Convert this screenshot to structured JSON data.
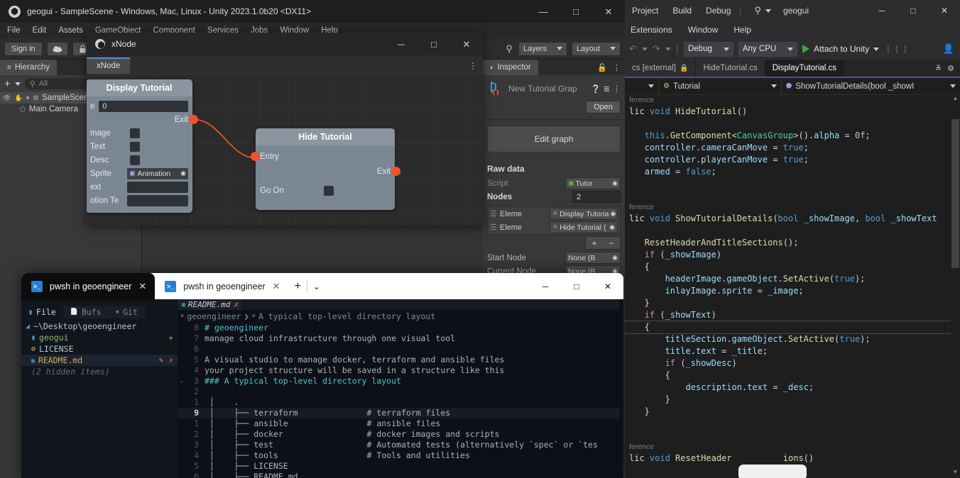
{
  "unity": {
    "title": "geogui - SampleScene - Windows, Mac, Linux - Unity 2023.1.0b20 <DX11>",
    "menu": [
      "File",
      "Edit",
      "Assets",
      "GameObject",
      "Component",
      "Services",
      "Jobs",
      "Window",
      "Help"
    ],
    "toolbar": {
      "sign_in": "Sign in",
      "cloud_icon": "cloud-icon",
      "account_icon": "lock-icon",
      "search_icon": "search-icon",
      "layers": "Layers",
      "layout": "Layout"
    },
    "hierarchy": {
      "tab": "Hierarchy",
      "add_label": "+",
      "search_placeholder": "All",
      "rows": [
        {
          "label": "SampleScene",
          "icon": "unity-scene-icon"
        },
        {
          "label": "Main Camera",
          "icon": "gameobject-icon"
        }
      ]
    },
    "inspector": {
      "tab": "Inspector",
      "lock_icon": "lock-icon",
      "kebab_icon": "kebab-icon",
      "asset_title": "New Tutorial Grap",
      "help_icon": "help-icon",
      "preset_icon": "preset-icon",
      "open_button": "Open",
      "edit_graph_button": "Edit graph",
      "raw_data_label": "Raw data",
      "script_label": "Script",
      "script_value": "Tutor",
      "nodes_label": "Nodes",
      "nodes_value": "2",
      "elements": [
        {
          "label": "Eleme",
          "value": "Display Tutoria"
        },
        {
          "label": "Eleme",
          "value": "Hide Tutorial ("
        }
      ],
      "plus": "+",
      "minus": "−",
      "start_node_label": "Start Node",
      "start_node_value": "None (B",
      "current_node_label": "Current Node",
      "current_node_value": "None (B"
    }
  },
  "xnode": {
    "window_title": "xNode",
    "tab": "xNode",
    "kebab_icon": "kebab-icon",
    "minimize": "─",
    "maximize": "□",
    "close": "✕",
    "nodes": [
      {
        "title": "Display Tutorial",
        "rows": [
          {
            "label": "e",
            "type": "field",
            "value": "0"
          },
          {
            "label": "Exit",
            "type": "port"
          },
          {
            "label": "mage",
            "type": "check"
          },
          {
            "label": "Text",
            "type": "check"
          },
          {
            "label": "Desc",
            "type": "check"
          },
          {
            "label": "Sprite",
            "type": "object",
            "value": "Animation"
          },
          {
            "label": "ext",
            "type": "field",
            "value": ""
          },
          {
            "label": "otion Te",
            "type": "field",
            "value": ""
          }
        ]
      },
      {
        "title": "Hide Tutorial",
        "rows": [
          {
            "label": "Entry",
            "type": "port-in"
          },
          {
            "label": "Exit",
            "type": "port-out"
          },
          {
            "label": "Go On",
            "type": "check"
          }
        ]
      }
    ]
  },
  "terminal": {
    "tabs": [
      {
        "label": "pwsh in geoengineer",
        "active": true,
        "icon": "pwsh-icon",
        "close": "✕"
      },
      {
        "label": "pwsh in geoengineer",
        "active": false,
        "icon": "pwsh-icon",
        "close": "✕"
      }
    ],
    "new_tab": "+",
    "dropdown": "⌄",
    "minimize": "─",
    "maximize": "□",
    "close": "✕",
    "tree": {
      "tabs": [
        {
          "label": "File",
          "icon": "folder-icon",
          "active": true
        },
        {
          "label": "Bufs",
          "icon": "buffer-icon",
          "active": false
        },
        {
          "label": "Git",
          "icon": "git-icon",
          "active": false
        }
      ],
      "root": "~\\Desktop\\geoengineer",
      "items": [
        {
          "label": "geogui",
          "icon": "folder-icon",
          "badge": "+",
          "selected": false
        },
        {
          "label": "LICENSE",
          "icon": "license-icon",
          "badge": "",
          "selected": false
        },
        {
          "label": "README.md",
          "icon": "markdown-icon",
          "badge": "✎",
          "badge2": "✗",
          "selected": true
        }
      ],
      "hidden_note": "(2 hidden items)"
    },
    "buffer_tab": {
      "label": "README.md",
      "icon": "markdown-icon",
      "close": "✗"
    },
    "breadcrumb": [
      "geoengineer",
      "A typical top-level directory layout"
    ],
    "lines": [
      {
        "num": "8",
        "fold": "",
        "text": "# geoengineer",
        "style": "head"
      },
      {
        "num": "7",
        "fold": "",
        "text": "manage cloud infrastructure through one visual tool",
        "style": "plain"
      },
      {
        "num": "6",
        "fold": "",
        "text": "",
        "style": "plain"
      },
      {
        "num": "5",
        "fold": "",
        "text": "A visual studio to manage docker, terraform and ansible files",
        "style": "plain"
      },
      {
        "num": "4",
        "fold": "",
        "text": "your project structure will be saved in a structure like this",
        "style": "plain"
      },
      {
        "num": "3",
        "fold": "⌄",
        "text": "### A typical top-level directory layout",
        "style": "head"
      },
      {
        "num": "2",
        "fold": "",
        "text": "",
        "style": "plain"
      },
      {
        "num": "1",
        "fold": "",
        "text": " │    .",
        "style": "plain"
      },
      {
        "num": "9",
        "fold": "",
        "text": " │    ├── terraform              # terraform files",
        "style": "plain",
        "current": true,
        "abs": true
      },
      {
        "num": "1",
        "fold": "",
        "text": " │    ├── ansible                # ansible files",
        "style": "plain"
      },
      {
        "num": "2",
        "fold": "",
        "text": " │    ├── docker                 # docker images and scripts",
        "style": "plain"
      },
      {
        "num": "3",
        "fold": "",
        "text": " │    ├── test                   # Automated tests (alternatively `spec` or `tes",
        "style": "plain"
      },
      {
        "num": "4",
        "fold": "",
        "text": " │    ├── tools                  # Tools and utilities",
        "style": "plain"
      },
      {
        "num": "5",
        "fold": "",
        "text": " │    ├── LICENSE",
        "style": "plain"
      },
      {
        "num": "6",
        "fold": "",
        "text": " │    ├── README.md",
        "style": "plain"
      }
    ]
  },
  "vs": {
    "menu_row1": [
      "Project",
      "Build",
      "Debug"
    ],
    "menu_row2": [
      "Extensions",
      "Window",
      "Help"
    ],
    "search_icon": "search-icon",
    "project_name": "geogui",
    "minimize": "─",
    "maximize": "□",
    "close": "✕",
    "undo_icon": "undo-icon",
    "redo_icon": "redo-icon",
    "config": "Debug",
    "platform": "Any CPU",
    "run_label": "Attach to Unity",
    "live_share_icon": "live-share-icon",
    "tabs": [
      {
        "label": "cs [external]",
        "icon": "lock-icon",
        "active": false
      },
      {
        "label": "HideTutorial.cs",
        "icon": "",
        "active": false
      },
      {
        "label": "DisplayTutorial.cs",
        "icon": "",
        "active": true
      }
    ],
    "tabs_overflow_icon": "chevron-down-icon",
    "navbar": {
      "left_caret": "▾",
      "type": "Tutorial",
      "type_icon": "class-icon",
      "member": "ShowTutorialDetails(bool _showI",
      "member_icon": "method-icon"
    },
    "code": [
      {
        "kind": "ref",
        "text": "ference"
      },
      {
        "kind": "code",
        "tokens": [
          [
            "pl",
            "lic "
          ],
          [
            "kw",
            "void "
          ],
          [
            "fn",
            "HideTutorial"
          ],
          [
            "pl",
            "()"
          ]
        ]
      },
      {
        "kind": "code",
        "tokens": [
          [
            "pl",
            ""
          ]
        ]
      },
      {
        "kind": "code",
        "tokens": [
          [
            "pl",
            "   "
          ],
          [
            "kw",
            "this"
          ],
          [
            "pl",
            "."
          ],
          [
            "fn",
            "GetComponent"
          ],
          [
            "pl",
            "<"
          ],
          [
            "typ",
            "CanvasGroup"
          ],
          [
            "pl",
            ">()."
          ],
          [
            "idf",
            "alpha"
          ],
          [
            "pl",
            " = "
          ],
          [
            "num",
            "0f"
          ],
          [
            "pl",
            ";"
          ]
        ]
      },
      {
        "kind": "code",
        "tokens": [
          [
            "pl",
            "   "
          ],
          [
            "idf",
            "controller"
          ],
          [
            "pl",
            "."
          ],
          [
            "idf",
            "cameraCanMove"
          ],
          [
            "pl",
            " = "
          ],
          [
            "kw",
            "true"
          ],
          [
            "pl",
            ";"
          ]
        ]
      },
      {
        "kind": "code",
        "tokens": [
          [
            "pl",
            "   "
          ],
          [
            "idf",
            "controller"
          ],
          [
            "pl",
            "."
          ],
          [
            "idf",
            "playerCanMove"
          ],
          [
            "pl",
            " = "
          ],
          [
            "kw",
            "true"
          ],
          [
            "pl",
            ";"
          ]
        ]
      },
      {
        "kind": "code",
        "tokens": [
          [
            "pl",
            "   "
          ],
          [
            "idf",
            "armed"
          ],
          [
            "pl",
            " = "
          ],
          [
            "kw",
            "false"
          ],
          [
            "pl",
            ";"
          ]
        ]
      },
      {
        "kind": "code",
        "tokens": [
          [
            "pl",
            ""
          ]
        ]
      },
      {
        "kind": "code",
        "tokens": [
          [
            "pl",
            ""
          ]
        ]
      },
      {
        "kind": "ref",
        "text": "ference"
      },
      {
        "kind": "code",
        "tokens": [
          [
            "pl",
            "lic "
          ],
          [
            "kw",
            "void "
          ],
          [
            "fn",
            "ShowTutorialDetails"
          ],
          [
            "pl",
            "("
          ],
          [
            "kw",
            "bool"
          ],
          [
            "pl",
            " "
          ],
          [
            "idf",
            "_showImage"
          ],
          [
            "pl",
            ", "
          ],
          [
            "kw",
            "bool"
          ],
          [
            "pl",
            " "
          ],
          [
            "idf",
            "_showText"
          ]
        ]
      },
      {
        "kind": "code",
        "tokens": [
          [
            "pl",
            ""
          ]
        ]
      },
      {
        "kind": "code",
        "tokens": [
          [
            "pl",
            "   "
          ],
          [
            "fn",
            "ResetHeaderAndTitleSections"
          ],
          [
            "pl",
            "();"
          ]
        ]
      },
      {
        "kind": "code",
        "tokens": [
          [
            "pl",
            "   "
          ],
          [
            "kw2",
            "if"
          ],
          [
            "pl",
            " ("
          ],
          [
            "idf",
            "_showImage"
          ],
          [
            "pl",
            ")"
          ]
        ]
      },
      {
        "kind": "code",
        "tokens": [
          [
            "pl",
            "   {"
          ]
        ]
      },
      {
        "kind": "code",
        "tokens": [
          [
            "pl",
            "       "
          ],
          [
            "idf",
            "headerImage"
          ],
          [
            "pl",
            "."
          ],
          [
            "idf",
            "gameObject"
          ],
          [
            "pl",
            "."
          ],
          [
            "fn",
            "SetActive"
          ],
          [
            "pl",
            "("
          ],
          [
            "kw",
            "true"
          ],
          [
            "pl",
            ");"
          ]
        ]
      },
      {
        "kind": "code",
        "tokens": [
          [
            "pl",
            "       "
          ],
          [
            "idf",
            "inlayImage"
          ],
          [
            "pl",
            "."
          ],
          [
            "idf",
            "sprite"
          ],
          [
            "pl",
            " = "
          ],
          [
            "idf",
            "_image"
          ],
          [
            "pl",
            ";"
          ]
        ]
      },
      {
        "kind": "code",
        "tokens": [
          [
            "pl",
            "   }"
          ]
        ]
      },
      {
        "kind": "code",
        "tokens": [
          [
            "pl",
            "   "
          ],
          [
            "kw2",
            "if"
          ],
          [
            "pl",
            " ("
          ],
          [
            "idf",
            "_showText"
          ],
          [
            "pl",
            ")"
          ]
        ]
      },
      {
        "kind": "code",
        "tokens": [
          [
            "pl",
            "   {"
          ]
        ],
        "hl": true
      },
      {
        "kind": "code",
        "tokens": [
          [
            "pl",
            "       "
          ],
          [
            "idf",
            "titleSection"
          ],
          [
            "pl",
            "."
          ],
          [
            "idf",
            "gameObject"
          ],
          [
            "pl",
            "."
          ],
          [
            "fn",
            "SetActive"
          ],
          [
            "pl",
            "("
          ],
          [
            "kw",
            "true"
          ],
          [
            "pl",
            ");"
          ]
        ]
      },
      {
        "kind": "code",
        "tokens": [
          [
            "pl",
            "       "
          ],
          [
            "idf",
            "title"
          ],
          [
            "pl",
            "."
          ],
          [
            "idf",
            "text"
          ],
          [
            "pl",
            " = "
          ],
          [
            "idf",
            "_title"
          ],
          [
            "pl",
            ";"
          ]
        ]
      },
      {
        "kind": "code",
        "tokens": [
          [
            "pl",
            "       "
          ],
          [
            "kw2",
            "if"
          ],
          [
            "pl",
            " ("
          ],
          [
            "idf",
            "_showDesc"
          ],
          [
            "pl",
            ")"
          ]
        ]
      },
      {
        "kind": "code",
        "tokens": [
          [
            "pl",
            "       {"
          ]
        ]
      },
      {
        "kind": "code",
        "tokens": [
          [
            "pl",
            "           "
          ],
          [
            "idf",
            "description"
          ],
          [
            "pl",
            "."
          ],
          [
            "idf",
            "text"
          ],
          [
            "pl",
            " = "
          ],
          [
            "idf",
            "_desc"
          ],
          [
            "pl",
            ";"
          ]
        ]
      },
      {
        "kind": "code",
        "tokens": [
          [
            "pl",
            "       }"
          ]
        ]
      },
      {
        "kind": "code",
        "tokens": [
          [
            "pl",
            "   }"
          ]
        ]
      },
      {
        "kind": "code",
        "tokens": [
          [
            "pl",
            ""
          ]
        ]
      },
      {
        "kind": "code",
        "tokens": [
          [
            "pl",
            ""
          ]
        ]
      },
      {
        "kind": "ref",
        "text": "ference"
      },
      {
        "kind": "code",
        "tokens": [
          [
            "pl",
            "lic "
          ],
          [
            "kw",
            "void "
          ],
          [
            "fn",
            "ResetHeader"
          ],
          [
            "pl",
            "          "
          ],
          [
            "fn",
            "ions"
          ],
          [
            "pl",
            "()"
          ]
        ]
      }
    ]
  },
  "colors": {
    "unity_bg": "#383838",
    "accent_blue": "#4a90d9",
    "port_orange": "#f0522a",
    "node_body": "#7a8793",
    "vs_bg": "#1e1e1e",
    "term_bg": "#0d1117"
  }
}
